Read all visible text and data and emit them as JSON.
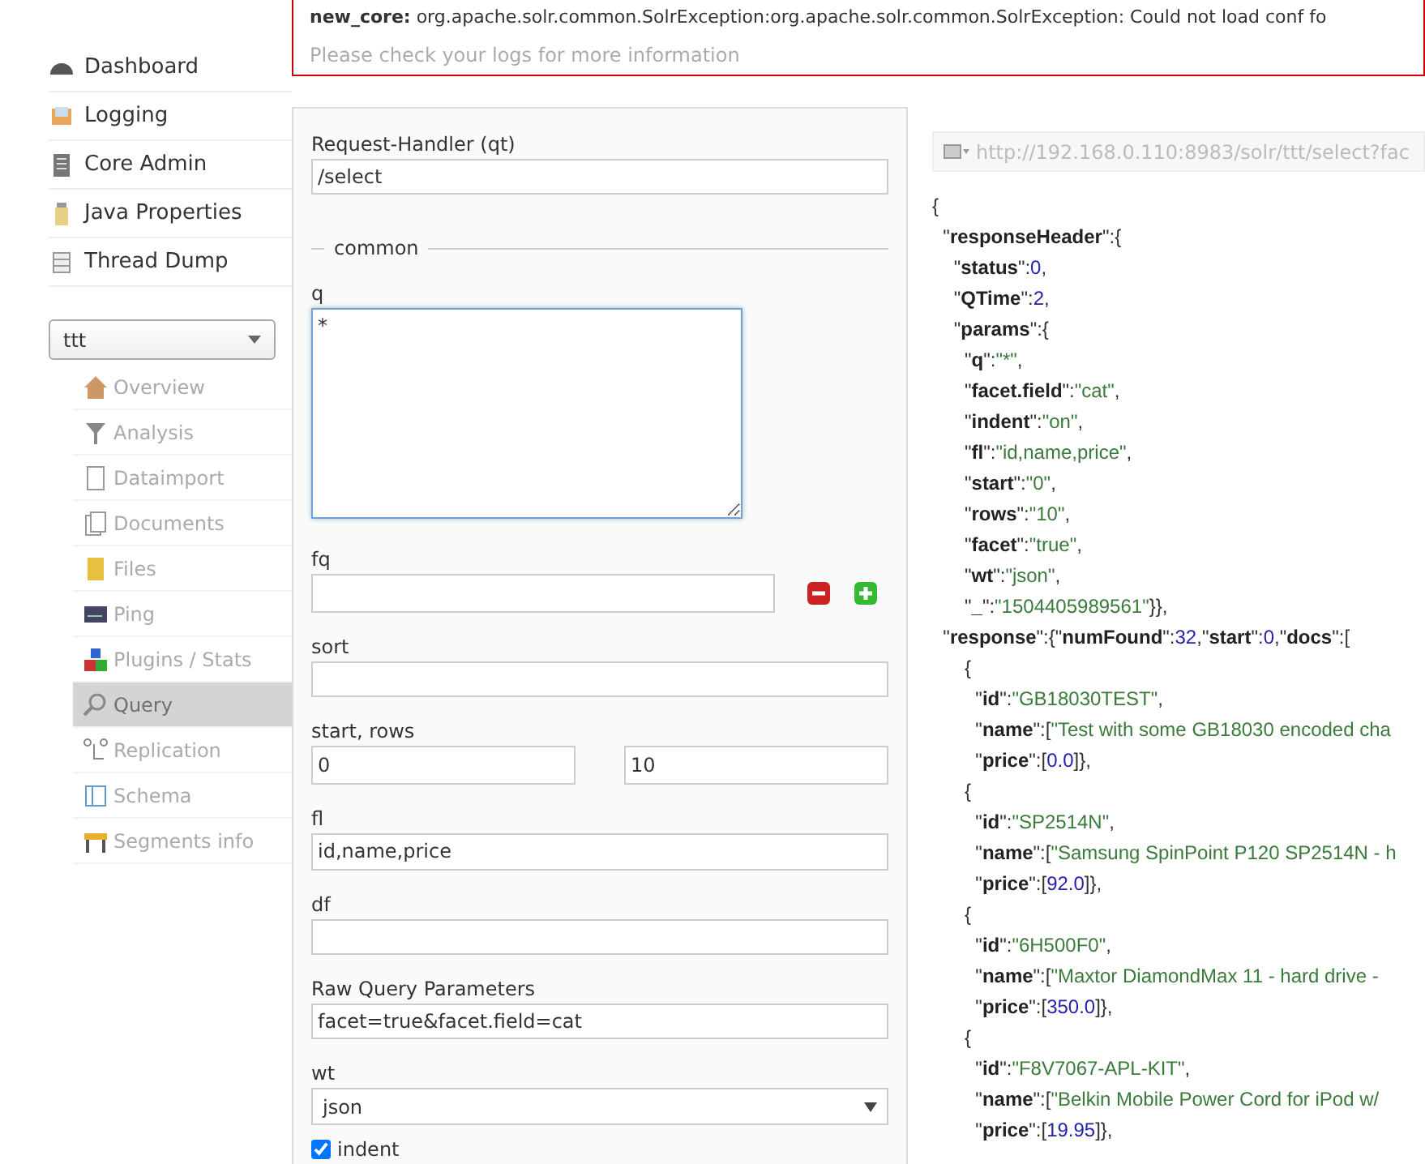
{
  "error": {
    "title": "new_core:",
    "message": "org.apache.solr.common.SolrException:org.apache.solr.common.SolrException: Could not load conf fo",
    "hint": "Please check your logs for more information"
  },
  "nav": [
    {
      "label": "Dashboard"
    },
    {
      "label": "Logging"
    },
    {
      "label": "Core Admin"
    },
    {
      "label": "Java Properties"
    },
    {
      "label": "Thread Dump"
    }
  ],
  "core_selector": {
    "value": "ttt"
  },
  "core_menu": [
    {
      "label": "Overview",
      "selected": false
    },
    {
      "label": "Analysis",
      "selected": false
    },
    {
      "label": "Dataimport",
      "selected": false
    },
    {
      "label": "Documents",
      "selected": false
    },
    {
      "label": "Files",
      "selected": false
    },
    {
      "label": "Ping",
      "selected": false
    },
    {
      "label": "Plugins / Stats",
      "selected": false
    },
    {
      "label": "Query",
      "selected": true
    },
    {
      "label": "Replication",
      "selected": false
    },
    {
      "label": "Schema",
      "selected": false
    },
    {
      "label": "Segments info",
      "selected": false
    }
  ],
  "form": [
    {
      "kind": "text",
      "label": "Request-Handler (qt)",
      "value": "/select"
    },
    {
      "kind": "legend",
      "label": "common"
    },
    {
      "kind": "textarea",
      "label": "q",
      "value": "*",
      "focused": true
    },
    {
      "kind": "multi",
      "label": "fq"
    },
    {
      "kind": "text",
      "label": "sort"
    },
    {
      "kind": "pair",
      "label": "start, rows",
      "value": "0",
      "value2": "10"
    },
    {
      "kind": "text",
      "label": "fl",
      "value": "id,name,price"
    },
    {
      "kind": "text",
      "label": "df"
    },
    {
      "kind": "text",
      "label": "Raw Query Parameters",
      "value": "facet=true&facet.field=cat"
    },
    {
      "kind": "select",
      "label": "wt",
      "value": "json"
    },
    {
      "kind": "checkbox",
      "label": "indent",
      "checked": true
    }
  ],
  "url": "http://192.168.0.110:8983/solr/ttt/select?fac",
  "response_lines": [
    [
      {
        "kind": "punct",
        "text": "{"
      }
    ],
    [
      {
        "kind": "punct",
        "text": "  \""
      },
      {
        "kind": "key",
        "text": "responseHeader"
      },
      {
        "kind": "punct",
        "text": "\":{"
      }
    ],
    [
      {
        "kind": "punct",
        "text": "    \""
      },
      {
        "kind": "key",
        "text": "status"
      },
      {
        "kind": "punct",
        "text": "\":"
      },
      {
        "kind": "number",
        "text": "0"
      },
      {
        "kind": "punct",
        "text": ","
      }
    ],
    [
      {
        "kind": "punct",
        "text": "    \""
      },
      {
        "kind": "key",
        "text": "QTime"
      },
      {
        "kind": "punct",
        "text": "\":"
      },
      {
        "kind": "number",
        "text": "2"
      },
      {
        "kind": "punct",
        "text": ","
      }
    ],
    [
      {
        "kind": "punct",
        "text": "    \""
      },
      {
        "kind": "key",
        "text": "params"
      },
      {
        "kind": "punct",
        "text": "\":{"
      }
    ],
    [
      {
        "kind": "punct",
        "text": "      \""
      },
      {
        "kind": "key",
        "text": "q"
      },
      {
        "kind": "punct",
        "text": "\":"
      },
      {
        "kind": "string",
        "text": "\"*\""
      },
      {
        "kind": "punct",
        "text": ","
      }
    ],
    [
      {
        "kind": "punct",
        "text": "      \""
      },
      {
        "kind": "key",
        "text": "facet.field"
      },
      {
        "kind": "punct",
        "text": "\":"
      },
      {
        "kind": "string",
        "text": "\"cat\""
      },
      {
        "kind": "punct",
        "text": ","
      }
    ],
    [
      {
        "kind": "punct",
        "text": "      \""
      },
      {
        "kind": "key",
        "text": "indent"
      },
      {
        "kind": "punct",
        "text": "\":"
      },
      {
        "kind": "string",
        "text": "\"on\""
      },
      {
        "kind": "punct",
        "text": ","
      }
    ],
    [
      {
        "kind": "punct",
        "text": "      \""
      },
      {
        "kind": "key",
        "text": "fl"
      },
      {
        "kind": "punct",
        "text": "\":"
      },
      {
        "kind": "string",
        "text": "\"id,name,price\""
      },
      {
        "kind": "punct",
        "text": ","
      }
    ],
    [
      {
        "kind": "punct",
        "text": "      \""
      },
      {
        "kind": "key",
        "text": "start"
      },
      {
        "kind": "punct",
        "text": "\":"
      },
      {
        "kind": "string",
        "text": "\"0\""
      },
      {
        "kind": "punct",
        "text": ","
      }
    ],
    [
      {
        "kind": "punct",
        "text": "      \""
      },
      {
        "kind": "key",
        "text": "rows"
      },
      {
        "kind": "punct",
        "text": "\":"
      },
      {
        "kind": "string",
        "text": "\"10\""
      },
      {
        "kind": "punct",
        "text": ","
      }
    ],
    [
      {
        "kind": "punct",
        "text": "      \""
      },
      {
        "kind": "key",
        "text": "facet"
      },
      {
        "kind": "punct",
        "text": "\":"
      },
      {
        "kind": "string",
        "text": "\"true\""
      },
      {
        "kind": "punct",
        "text": ","
      }
    ],
    [
      {
        "kind": "punct",
        "text": "      \""
      },
      {
        "kind": "key",
        "text": "wt"
      },
      {
        "kind": "punct",
        "text": "\":"
      },
      {
        "kind": "string",
        "text": "\"json\""
      },
      {
        "kind": "punct",
        "text": ","
      }
    ],
    [
      {
        "kind": "punct",
        "text": "      \""
      },
      {
        "kind": "key",
        "text": "_"
      },
      {
        "kind": "punct",
        "text": "\":"
      },
      {
        "kind": "string",
        "text": "\"1504405989561\""
      },
      {
        "kind": "punct",
        "text": "}},"
      }
    ],
    [
      {
        "kind": "punct",
        "text": "  \""
      },
      {
        "kind": "key",
        "text": "response"
      },
      {
        "kind": "punct",
        "text": "\":{\""
      },
      {
        "kind": "key",
        "text": "numFound"
      },
      {
        "kind": "punct",
        "text": "\":"
      },
      {
        "kind": "number",
        "text": "32"
      },
      {
        "kind": "punct",
        "text": ",\""
      },
      {
        "kind": "key",
        "text": "start"
      },
      {
        "kind": "punct",
        "text": "\":"
      },
      {
        "kind": "number",
        "text": "0"
      },
      {
        "kind": "punct",
        "text": ",\""
      },
      {
        "kind": "key",
        "text": "docs"
      },
      {
        "kind": "punct",
        "text": "\":["
      }
    ],
    [
      {
        "kind": "punct",
        "text": "      {"
      }
    ],
    [
      {
        "kind": "punct",
        "text": "        \""
      },
      {
        "kind": "key",
        "text": "id"
      },
      {
        "kind": "punct",
        "text": "\":"
      },
      {
        "kind": "string",
        "text": "\"GB18030TEST\""
      },
      {
        "kind": "punct",
        "text": ","
      }
    ],
    [
      {
        "kind": "punct",
        "text": "        \""
      },
      {
        "kind": "key",
        "text": "name"
      },
      {
        "kind": "punct",
        "text": "\":["
      },
      {
        "kind": "string",
        "text": "\"Test with some GB18030 encoded cha"
      }
    ],
    [
      {
        "kind": "punct",
        "text": "        \""
      },
      {
        "kind": "key",
        "text": "price"
      },
      {
        "kind": "punct",
        "text": "\":["
      },
      {
        "kind": "number",
        "text": "0.0"
      },
      {
        "kind": "punct",
        "text": "]},"
      }
    ],
    [
      {
        "kind": "punct",
        "text": "      {"
      }
    ],
    [
      {
        "kind": "punct",
        "text": "        \""
      },
      {
        "kind": "key",
        "text": "id"
      },
      {
        "kind": "punct",
        "text": "\":"
      },
      {
        "kind": "string",
        "text": "\"SP2514N\""
      },
      {
        "kind": "punct",
        "text": ","
      }
    ],
    [
      {
        "kind": "punct",
        "text": "        \""
      },
      {
        "kind": "key",
        "text": "name"
      },
      {
        "kind": "punct",
        "text": "\":["
      },
      {
        "kind": "string",
        "text": "\"Samsung SpinPoint P120 SP2514N - h"
      }
    ],
    [
      {
        "kind": "punct",
        "text": "        \""
      },
      {
        "kind": "key",
        "text": "price"
      },
      {
        "kind": "punct",
        "text": "\":["
      },
      {
        "kind": "number",
        "text": "92.0"
      },
      {
        "kind": "punct",
        "text": "]},"
      }
    ],
    [
      {
        "kind": "punct",
        "text": "      {"
      }
    ],
    [
      {
        "kind": "punct",
        "text": "        \""
      },
      {
        "kind": "key",
        "text": "id"
      },
      {
        "kind": "punct",
        "text": "\":"
      },
      {
        "kind": "string",
        "text": "\"6H500F0\""
      },
      {
        "kind": "punct",
        "text": ","
      }
    ],
    [
      {
        "kind": "punct",
        "text": "        \""
      },
      {
        "kind": "key",
        "text": "name"
      },
      {
        "kind": "punct",
        "text": "\":["
      },
      {
        "kind": "string",
        "text": "\"Maxtor DiamondMax 11 - hard drive -"
      }
    ],
    [
      {
        "kind": "punct",
        "text": "        \""
      },
      {
        "kind": "key",
        "text": "price"
      },
      {
        "kind": "punct",
        "text": "\":["
      },
      {
        "kind": "number",
        "text": "350.0"
      },
      {
        "kind": "punct",
        "text": "]},"
      }
    ],
    [
      {
        "kind": "punct",
        "text": "      {"
      }
    ],
    [
      {
        "kind": "punct",
        "text": "        \""
      },
      {
        "kind": "key",
        "text": "id"
      },
      {
        "kind": "punct",
        "text": "\":"
      },
      {
        "kind": "string",
        "text": "\"F8V7067-APL-KIT\""
      },
      {
        "kind": "punct",
        "text": ","
      }
    ],
    [
      {
        "kind": "punct",
        "text": "        \""
      },
      {
        "kind": "key",
        "text": "name"
      },
      {
        "kind": "punct",
        "text": "\":["
      },
      {
        "kind": "string",
        "text": "\"Belkin Mobile Power Cord for iPod w/"
      }
    ],
    [
      {
        "kind": "punct",
        "text": "        \""
      },
      {
        "kind": "key",
        "text": "price"
      },
      {
        "kind": "punct",
        "text": "\":["
      },
      {
        "kind": "number",
        "text": "19.95"
      },
      {
        "kind": "punct",
        "text": "]},"
      }
    ]
  ]
}
